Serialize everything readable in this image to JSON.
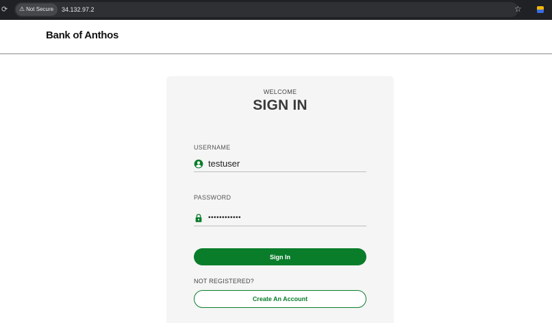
{
  "browser": {
    "security_chip": "Not Secure",
    "url": "34.132.97.2"
  },
  "header": {
    "brand": "Bank of Anthos"
  },
  "login": {
    "welcome": "WELCOME",
    "title": "SIGN IN",
    "username_label": "USERNAME",
    "username_value": "testuser",
    "password_label": "PASSWORD",
    "password_value": "••••••••••••",
    "sign_in_label": "Sign In",
    "not_registered": "NOT REGISTERED?",
    "create_account_label": "Create An Account"
  },
  "colors": {
    "accent": "#0a7d2b",
    "chrome_bg": "#202124",
    "card_bg": "#f5f5f5"
  },
  "icons": {
    "username": "account-circle-icon",
    "password": "lock-icon",
    "reload": "reload-icon",
    "warning": "warning-triangle-icon",
    "bookmark": "star-icon",
    "extension": "extension-icon"
  }
}
